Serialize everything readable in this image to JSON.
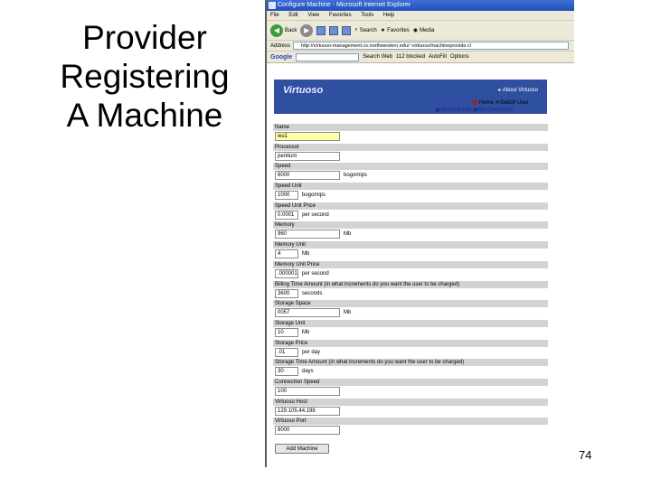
{
  "slide": {
    "title_lines": [
      "Provider",
      "Registering",
      "A Machine"
    ],
    "page_number": "74"
  },
  "browser": {
    "window_title": "Configure Machine - Microsoft Internet Explorer",
    "menu": [
      "File",
      "Edit",
      "View",
      "Favorites",
      "Tools",
      "Help"
    ],
    "toolbar": {
      "back": "Back",
      "search": "Search",
      "favorites": "Favorites",
      "media": "Media"
    },
    "address_label": "Address",
    "address_value": "http://virtuoso-management.cs.northwestern.edu/~virtuoso/machineprovide.cl",
    "google": {
      "logo": "Google",
      "search_web": "Search Web",
      "blocked": "112 blocked",
      "autofill": "AutoFill",
      "options": "Options"
    }
  },
  "site": {
    "logo": "Virtuoso",
    "about_link": "About Virtuoso",
    "nav": {
      "home": "Home",
      "switch_user": "Switch User",
      "account_info": "Account Info",
      "my_computers": "My Computers"
    }
  },
  "form": {
    "fields": [
      {
        "label": "Name",
        "value": "wu1",
        "unit": "",
        "highlight": true
      },
      {
        "label": "Processor",
        "value": "pentium",
        "unit": ""
      },
      {
        "label": "Speed",
        "value": "6000",
        "unit": "bogomips"
      },
      {
        "label": "Speed Unit",
        "value": "1000",
        "unit": "bogomips",
        "short": true
      },
      {
        "label": "Speed Unit Price",
        "value": "0.0001",
        "unit": "per second",
        "short": true
      },
      {
        "label": "Memory",
        "value": "960",
        "unit": "Mb"
      },
      {
        "label": "Memory Unit",
        "value": "4",
        "unit": "Mb",
        "short": true
      },
      {
        "label": "Memory Unit Price",
        "value": ".000001",
        "unit": "per second",
        "short": true
      },
      {
        "label": "Billing Time Amount (in what increments do you want the user to be charged)",
        "value": "3600",
        "unit": "seconds",
        "short": true
      },
      {
        "label": "Storage Space",
        "value": "0057",
        "unit": "Mb"
      },
      {
        "label": "Storage Unit",
        "value": "10",
        "unit": "Mb",
        "short": true
      },
      {
        "label": "Storage Price",
        "value": ".01",
        "unit": "per day",
        "short": true
      },
      {
        "label": "Storage Time Amount (in what increments do you want the user to be charged)",
        "value": "30",
        "unit": "days",
        "short": true
      },
      {
        "label": "Connection Speed",
        "value": "100",
        "unit": ""
      },
      {
        "label": "Virtuoso Host",
        "value": "129.105.44.198",
        "unit": ""
      },
      {
        "label": "Virtuoso Port",
        "value": "8000",
        "unit": ""
      }
    ],
    "submit_label": "Add Machine"
  }
}
